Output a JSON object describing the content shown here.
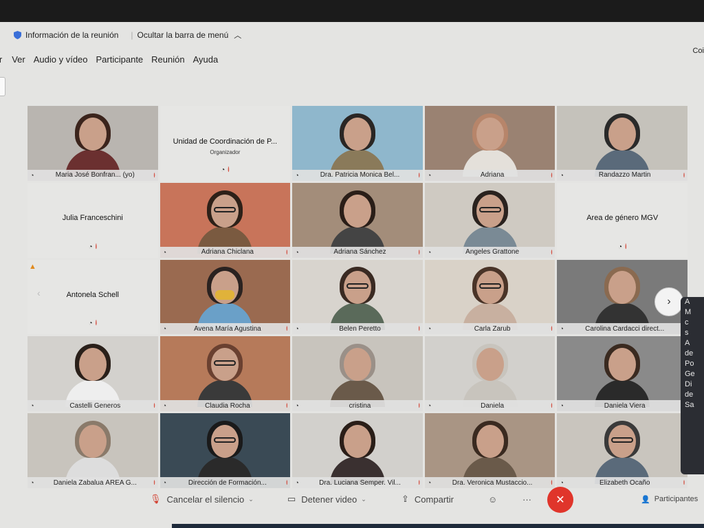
{
  "infobar": {
    "meeting_info": "Información de la reunión",
    "hide_menu": "Ocultar la barra de menú"
  },
  "corner_text": "Coi",
  "menu": [
    "ir",
    "Ver",
    "Audio y vídeo",
    "Participante",
    "Reunión",
    "Ayuda"
  ],
  "tiles": [
    {
      "name": "Maria José Bonfran... (yo)",
      "type": "photo",
      "bg": "#b9b5b0",
      "hair": "#3b241c",
      "body": "#6b3030"
    },
    {
      "name": "Unidad de Coordinación de P...",
      "sub": "Organizador",
      "type": "name-only"
    },
    {
      "name": "Dra. Patricia Monica Bel...",
      "type": "photo",
      "bg": "#8fb7cc",
      "hair": "#2a2624",
      "body": "#8a7a5a"
    },
    {
      "name": "Adriana",
      "type": "photo",
      "bg": "#9a8272",
      "hair": "#b7856a",
      "body": "#e4e0da"
    },
    {
      "name": "Randazzo Martin",
      "type": "photo",
      "bg": "#c5c2bb",
      "hair": "#2a2a2a",
      "body": "#5a6a7a"
    },
    {
      "name": "Julia Franceschini",
      "type": "name-only"
    },
    {
      "name": "Adriana Chiclana",
      "type": "photo",
      "bg": "#c8745a",
      "hair": "#2d2018",
      "body": "#7a5a40",
      "glasses": true
    },
    {
      "name": "Adriana Sánchez",
      "type": "photo",
      "bg": "#a38d7a",
      "hair": "#2a1e18",
      "body": "#444"
    },
    {
      "name": "Angeles Grattone",
      "type": "photo",
      "bg": "#cfcac2",
      "hair": "#2a221e",
      "body": "#7a8a95",
      "glasses": true
    },
    {
      "name": "Area de género MGV",
      "type": "name-only"
    },
    {
      "name": "Antonela Schell",
      "type": "name-only"
    },
    {
      "name": "Avena María Agustina",
      "type": "photo",
      "bg": "#9a6a50",
      "hair": "#2a2220",
      "body": "#6aa0c8",
      "mask": true
    },
    {
      "name": "Belen Peretto",
      "type": "photo",
      "bg": "#d8d4ce",
      "hair": "#3a2a22",
      "body": "#5a6a5a",
      "glasses": true
    },
    {
      "name": "Carla Zarub",
      "type": "photo",
      "bg": "#d9d2c8",
      "hair": "#4a3428",
      "body": "#c8b0a0",
      "glasses": true
    },
    {
      "name": "Carolina Cardacci direct...",
      "type": "photo",
      "bg": "#7a7a7a",
      "hair": "#8a6a50",
      "body": "#333"
    },
    {
      "name": "Castelli Generos",
      "type": "photo",
      "bg": "#d3d1cd",
      "hair": "#2a201a",
      "body": "#eeeeee"
    },
    {
      "name": "Claudia Rocha",
      "type": "photo",
      "bg": "#b67a5a",
      "hair": "#6a4030",
      "body": "#3a3a3a",
      "glasses": true
    },
    {
      "name": "cristina",
      "type": "photo",
      "bg": "#c8c4bd",
      "hair": "#9a9088",
      "body": "#6a5a4a"
    },
    {
      "name": "Daniela",
      "type": "photo",
      "bg": "#d2d0cc",
      "hair": "#c8c4bd",
      "body": "#c8c4bd"
    },
    {
      "name": "Daniela Viera",
      "type": "photo",
      "bg": "#8a8a8a",
      "hair": "#3a2a20",
      "body": "#2a2a2a"
    },
    {
      "name": "Daniela Zabalua ÁREA G...",
      "type": "photo",
      "bg": "#c8c4bd",
      "hair": "#8a7a6a",
      "body": "#ddd"
    },
    {
      "name": "Dirección de Formación...",
      "type": "photo",
      "bg": "#3a4a55",
      "hair": "#1a1a1a",
      "body": "#2a2a2a",
      "glasses": true
    },
    {
      "name": "Dra. Luciana Semper. Vil...",
      "type": "photo",
      "bg": "#d2d0cc",
      "hair": "#2a1e18",
      "body": "#3a3030"
    },
    {
      "name": "Dra. Veronica Mustaccio...",
      "type": "photo",
      "bg": "#a99584",
      "hair": "#3a2a20",
      "body": "#6a5a4a"
    },
    {
      "name": "Elizabeth Ocaño",
      "type": "photo",
      "bg": "#c9c5be",
      "hair": "#3a3a3a",
      "body": "#5a6a7a",
      "glasses": true
    }
  ],
  "chat_lines": [
    "A",
    "M",
    "c",
    "s",
    "A",
    "",
    "de",
    "Po",
    "Ge",
    "Di",
    "de",
    "Sa"
  ],
  "toolbar": {
    "unmute": "Cancelar el silencio",
    "stop_video": "Detener video",
    "share": "Compartir",
    "more": "···",
    "participants": "Participantes"
  },
  "colors": {
    "end_button": "#e0352b",
    "muted_icon": "#d23a2a",
    "warning": "#e08a1e"
  }
}
